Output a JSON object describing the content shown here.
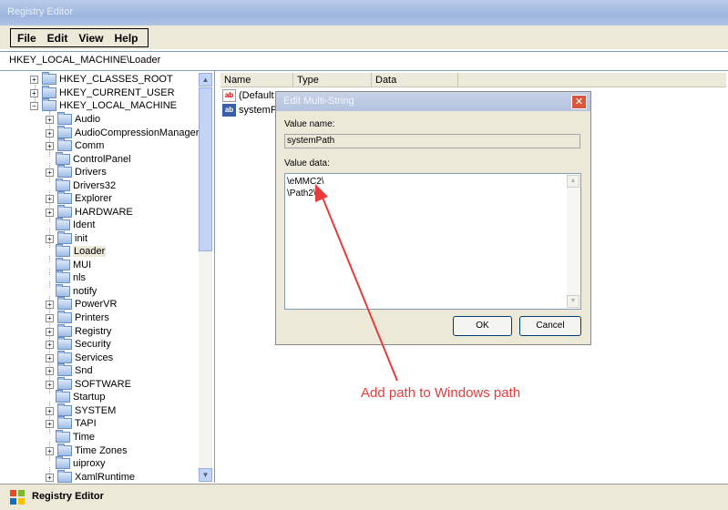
{
  "window": {
    "title": "Registry Editor"
  },
  "menu": {
    "items": [
      "File",
      "Edit",
      "View",
      "Help"
    ]
  },
  "address": {
    "path": "HKEY_LOCAL_MACHINE\\Loader"
  },
  "tree": {
    "roots": [
      "HKEY_CLASSES_ROOT",
      "HKEY_CURRENT_USER",
      "HKEY_LOCAL_MACHINE"
    ],
    "children": [
      "Audio",
      "AudioCompressionManager",
      "Comm",
      "ControlPanel",
      "Drivers",
      "Drivers32",
      "Explorer",
      "HARDWARE",
      "Ident",
      "init",
      "Loader",
      "MUI",
      "nls",
      "notify",
      "PowerVR",
      "Printers",
      "Registry",
      "Security",
      "Services",
      "Snd",
      "SOFTWARE",
      "Startup",
      "SYSTEM",
      "TAPI",
      "Time",
      "Time Zones",
      "uiproxy",
      "XamlRuntime"
    ],
    "selected": "Loader"
  },
  "list": {
    "columns": [
      "Name",
      "Type",
      "Data"
    ],
    "rows": [
      "(Default",
      "systemP"
    ]
  },
  "dialog": {
    "title": "Edit Multi-String",
    "value_name_label": "Value name:",
    "value_name": "systemPath",
    "value_data_label": "Value data:",
    "value_data_lines": [
      "\\eMMC2\\",
      "\\Path2\\"
    ],
    "ok_label": "OK",
    "cancel_label": "Cancel",
    "close_glyph": "✕"
  },
  "annotation": {
    "text": "Add path to Windows path",
    "color": "#e83b3b"
  },
  "taskbar": {
    "label": "Registry Editor"
  }
}
